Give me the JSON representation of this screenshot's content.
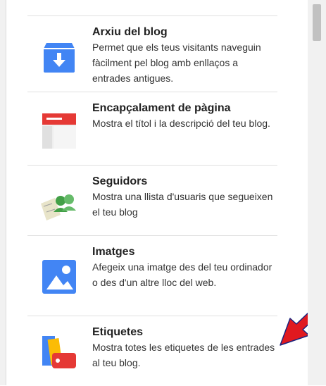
{
  "gadgets": [
    {
      "title": "Arxiu del blog",
      "description": "Permet que els teus visitants naveguin fàcilment pel blog amb enllaços a entrades antigues.",
      "icon": "archive-download-icon"
    },
    {
      "title": "Encapçalament de pàgina",
      "description": "Mostra el títol i la descripció del teu blog.",
      "icon": "page-header-icon"
    },
    {
      "title": "Seguidors",
      "description": "Mostra una llista d'usuaris que segueixen el teu blog",
      "icon": "followers-icon"
    },
    {
      "title": "Imatges",
      "description": "Afegeix una imatge des del teu ordinador o des d'un altre lloc del web.",
      "icon": "image-icon"
    },
    {
      "title": "Etiquetes",
      "description": "Mostra totes les etiquetes de les entrades al teu blog.",
      "icon": "labels-icon"
    }
  ],
  "colors": {
    "blue": "#4285f4",
    "red": "#e53935",
    "green": "#4caf50",
    "yellow": "#fbbc05",
    "arrow": "#e0191f"
  }
}
